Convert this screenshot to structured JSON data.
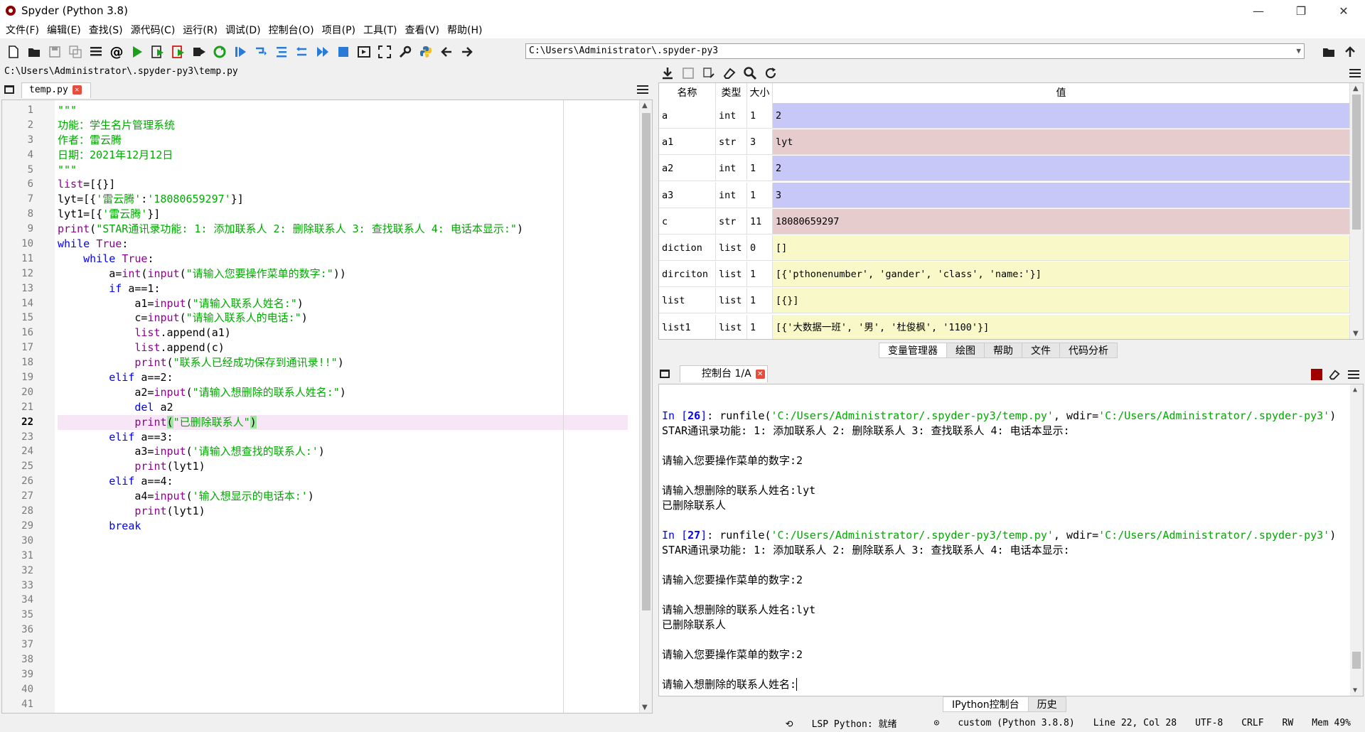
{
  "window": {
    "title": "Spyder (Python 3.8)",
    "controls": [
      "—",
      "❐",
      "✕"
    ]
  },
  "menubar": [
    "文件(F)",
    "编辑(E)",
    "查找(S)",
    "源代码(C)",
    "运行(R)",
    "调试(D)",
    "控制台(O)",
    "项目(P)",
    "工具(T)",
    "查看(V)",
    "帮助(H)"
  ],
  "toolbar": {
    "path": "C:\\Users\\Administrator\\.spyder-py3"
  },
  "editor": {
    "file_path": "C:\\Users\\Administrator\\.spyder-py3\\temp.py",
    "tab_label": "temp.py",
    "current_line": 22,
    "line_count": 41
  },
  "variables": {
    "headers": [
      "名称",
      "类型",
      "大小",
      "值"
    ],
    "rows": [
      {
        "name": "a",
        "type": "int",
        "size": "1",
        "value": "2",
        "color": "#c8c8f8"
      },
      {
        "name": "a1",
        "type": "str",
        "size": "3",
        "value": "lyt",
        "color": "#e6cccc"
      },
      {
        "name": "a2",
        "type": "int",
        "size": "1",
        "value": "2",
        "color": "#c8c8f8"
      },
      {
        "name": "a3",
        "type": "int",
        "size": "1",
        "value": "3",
        "color": "#c8c8f8"
      },
      {
        "name": "c",
        "type": "str",
        "size": "11",
        "value": "18080659297",
        "color": "#e6cccc"
      },
      {
        "name": "diction",
        "type": "list",
        "size": "0",
        "value": "[]",
        "color": "#f8f8c8"
      },
      {
        "name": "dirciton",
        "type": "list",
        "size": "1",
        "value": "[{'pthonenumber', 'gander', 'class', 'name:'}]",
        "color": "#f8f8c8"
      },
      {
        "name": "list",
        "type": "list",
        "size": "1",
        "value": "[{}]",
        "color": "#f8f8c8"
      },
      {
        "name": "list1",
        "type": "list",
        "size": "1",
        "value": "[{'大数据一班', '男', '杜俊枫', '1100'}]",
        "color": "#f8f8c8"
      }
    ]
  },
  "pane_tabs": [
    "变量管理器",
    "绘图",
    "帮助",
    "文件",
    "代码分析"
  ],
  "console": {
    "tab_label": "控制台 1/A",
    "bottom_tabs": [
      "IPython控制台",
      "历史"
    ],
    "run1_num": "26",
    "run2_num": "27",
    "run_cmd": "runfile(",
    "run_file": "'C:/Users/Administrator/.spyder-py3/temp.py'",
    "run_wdir_label": ", wdir=",
    "run_wdir": "'C:/Users/Administrator/.spyder-py3'",
    "run_close": ")",
    "menu_text": "STAR通讯录功能: 1: 添加联系人 2: 删除联系人 3: 查找联系人 4: 电话本显示:",
    "prompt_menu": "请输入您要操作菜单的数字:2",
    "prompt_delete": "请输入想删除的联系人姓名:lyt",
    "deleted": "已删除联系人",
    "prompt_delete_open": "请输入想删除的联系人姓名:"
  },
  "statusbar": {
    "lsp": "LSP Python: 就绪",
    "env": "custom (Python 3.8.8)",
    "position": "Line 22, Col 28",
    "encoding": "UTF-8",
    "eol": "CRLF",
    "perm": "RW",
    "mem": "Mem 49%"
  }
}
